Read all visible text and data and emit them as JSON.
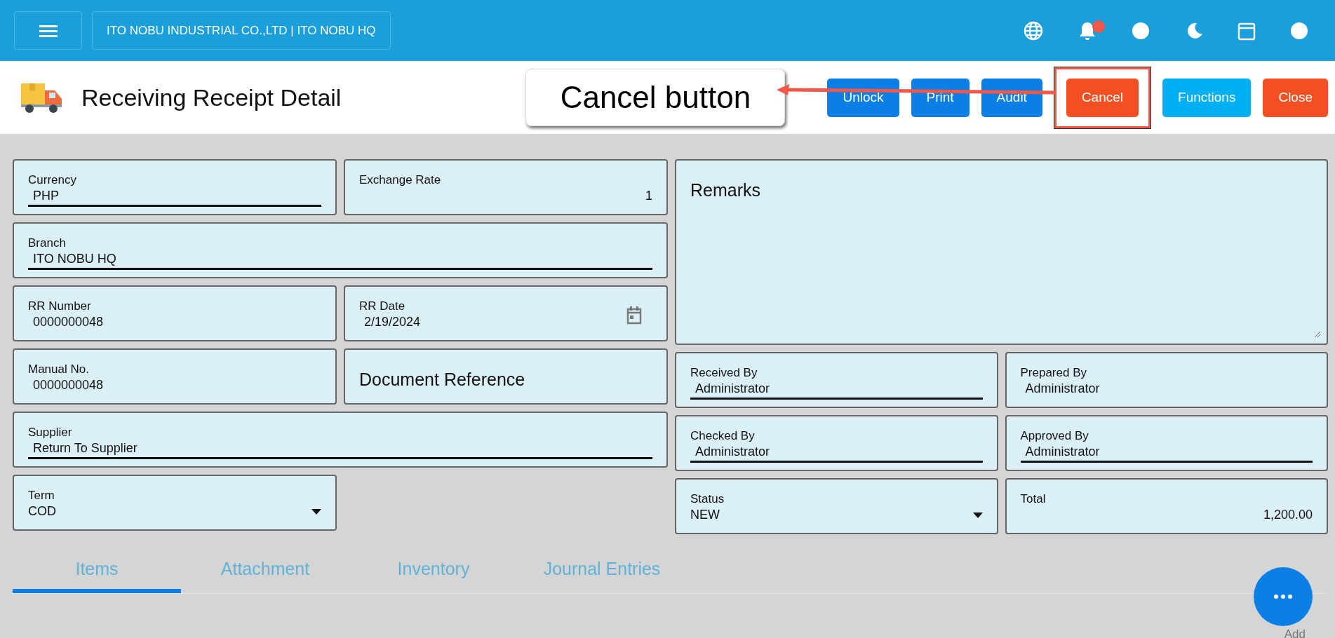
{
  "header": {
    "company": "ITO NOBU INDUSTRIAL CO.,LTD | ITO NOBU HQ",
    "notification_badge": true
  },
  "page": {
    "title": "Receiving Receipt Detail"
  },
  "buttons": [
    {
      "label": "Unlock",
      "kind": "primary",
      "highlighted": false
    },
    {
      "label": "Print",
      "kind": "primary",
      "highlighted": false
    },
    {
      "label": "Audit",
      "kind": "primary",
      "highlighted": false
    },
    {
      "label": "Cancel",
      "kind": "danger",
      "highlighted": true
    },
    {
      "label": "Functions",
      "kind": "info",
      "highlighted": false
    },
    {
      "label": "Close",
      "kind": "danger",
      "highlighted": false
    }
  ],
  "annotation": {
    "label": "Cancel button"
  },
  "left_fields": [
    {
      "label": "Currency",
      "value": "PHP",
      "kind": "underline",
      "wide": false
    },
    {
      "label": "Exchange Rate",
      "value": "1",
      "kind": "number",
      "wide": false
    },
    {
      "label": "Branch",
      "value": "ITO NOBU HQ",
      "kind": "underline",
      "wide": true
    },
    {
      "label": "RR Number",
      "value": "0000000048",
      "kind": "plain",
      "wide": false
    },
    {
      "label": "RR Date",
      "value": "2/19/2024",
      "kind": "date",
      "wide": false
    },
    {
      "label": "Manual No.",
      "value": "0000000048",
      "kind": "plain",
      "wide": false
    },
    {
      "label": "Document Reference",
      "kind": "heading",
      "wide": false
    },
    {
      "label": "Supplier",
      "value": "Return To Supplier",
      "kind": "underline",
      "wide": true
    },
    {
      "label": "Term",
      "value": "COD",
      "kind": "dropdown",
      "wide": false
    }
  ],
  "remarks": {
    "label": "Remarks"
  },
  "right_fields": [
    {
      "label": "Received By",
      "value": "Administrator",
      "kind": "underline"
    },
    {
      "label": "Prepared By",
      "value": "Administrator",
      "kind": "plain"
    },
    {
      "label": "Checked By",
      "value": "Administrator",
      "kind": "underline"
    },
    {
      "label": "Approved By",
      "value": "Administrator",
      "kind": "underline"
    },
    {
      "label": "Status",
      "value": "NEW",
      "kind": "dropdown"
    },
    {
      "label": "Total",
      "value": "1,200.00",
      "kind": "number"
    }
  ],
  "tabs": [
    {
      "label": "Items",
      "selected": true
    },
    {
      "label": "Attachment",
      "selected": false
    },
    {
      "label": "Inventory",
      "selected": false
    },
    {
      "label": "Journal Entries",
      "selected": false
    }
  ],
  "add_label": "Add"
}
